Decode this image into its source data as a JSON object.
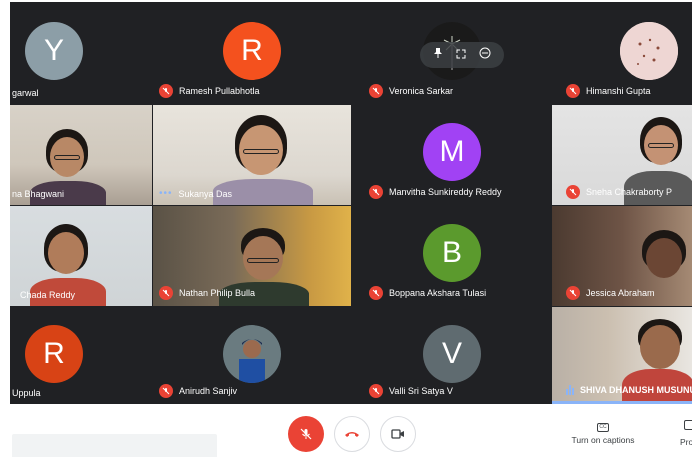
{
  "participants": [
    {
      "name": "garwal",
      "initial": "Y",
      "color": "#8c9ea7",
      "muted": false
    },
    {
      "name": "Ramesh Pullabhotla",
      "initial": "R",
      "color": "#f4511e",
      "muted": true
    },
    {
      "name": "Veronica Sarkar",
      "muted": true
    },
    {
      "name": "Himanshi Gupta",
      "muted": true
    },
    {
      "name": "na Bhagwani",
      "muted": false
    },
    {
      "name": "Sukanya Das",
      "muted": false,
      "speaking": true
    },
    {
      "name": "Manvitha Sunkireddy Reddy",
      "initial": "M",
      "color": "#a142f4",
      "muted": true
    },
    {
      "name": "Sneha Chakraborty P",
      "muted": true
    },
    {
      "name": "Chada Reddy",
      "muted": false
    },
    {
      "name": "Nathan Philip Bulla",
      "muted": true
    },
    {
      "name": "Boppana Akshara Tulasi",
      "initial": "B",
      "color": "#5b9a2d",
      "muted": true
    },
    {
      "name": "Jessica Abraham",
      "muted": true
    },
    {
      "name": "Uppula",
      "initial": "R",
      "color": "#d84315",
      "muted": false
    },
    {
      "name": "Anirudh Sanjiv",
      "muted": true
    },
    {
      "name": "Valli Sri Satya V",
      "initial": "V",
      "color": "#5f6b70",
      "muted": true
    },
    {
      "name": "SHIVA DHANUSH MUSUNUR",
      "muted": false,
      "active": true
    }
  ],
  "toolbar": {
    "captions_label": "Turn on captions",
    "more_label": "Pro",
    "cc_text": "CC"
  },
  "colors": {
    "accent_red": "#ea4335",
    "meet_bg": "#202124",
    "active_outline": "#8ab4f8"
  }
}
